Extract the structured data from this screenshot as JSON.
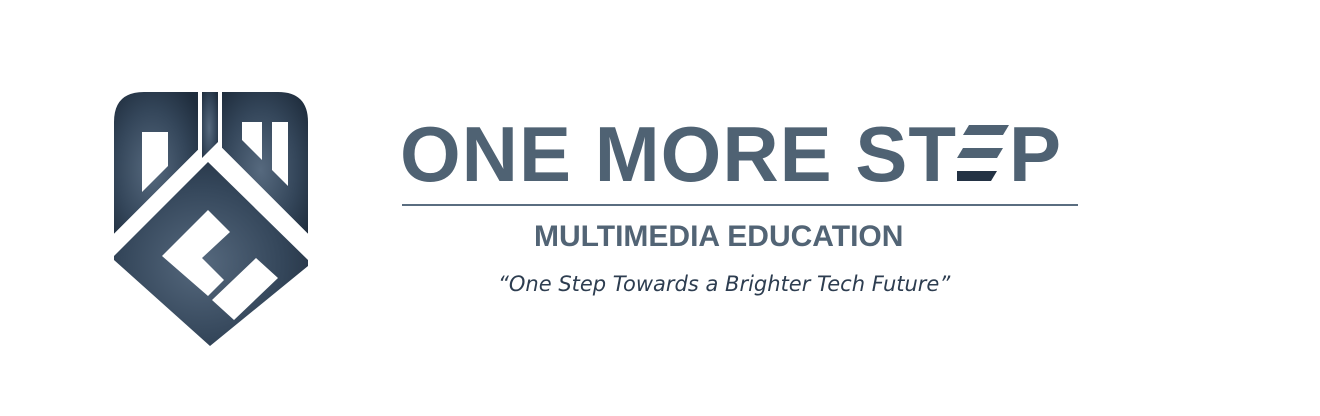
{
  "brand": {
    "name_part1": "ONE MORE ST",
    "name_part2": "P",
    "subtitle": "MULTIMEDIA EDUCATION",
    "tagline": "“One Step Towards a Brighter Tech Future”",
    "monogram": "OMS"
  },
  "colors": {
    "primary": "#4f6273",
    "dark": "#233244",
    "shield_light": "#52677d",
    "shield_dark": "#1f2d3d",
    "background": "#ffffff"
  },
  "icons": {
    "shield": "oms-shield-logo-icon",
    "stylized_e": "stylized-e-stripes-icon"
  }
}
